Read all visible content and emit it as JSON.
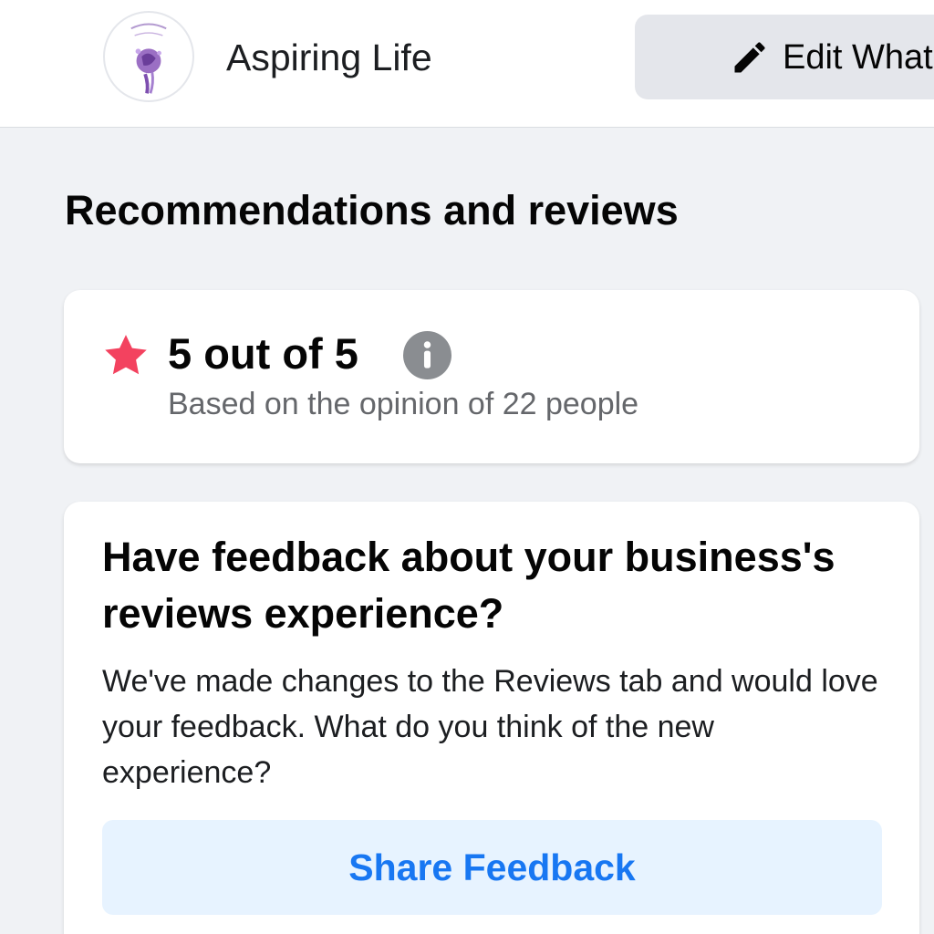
{
  "header": {
    "page_name": "Aspiring Life",
    "edit_button_label": "Edit What"
  },
  "section": {
    "title": "Recommendations and reviews"
  },
  "rating": {
    "value_text": "5 out of 5",
    "score": 5,
    "max": 5,
    "subtext": "Based on the opinion of 22 people",
    "star_color": "#f3425f"
  },
  "feedback": {
    "title": "Have feedback about your business's reviews experience?",
    "body": "We've made changes to the Reviews tab and would love your feedback. What do you think of the new experience?",
    "button_label": "Share Feedback",
    "button_color": "#1877f2"
  },
  "icons": {
    "avatar": "aspiring-life-logo",
    "edit": "pencil-icon",
    "star": "star-icon",
    "info": "info-icon"
  }
}
